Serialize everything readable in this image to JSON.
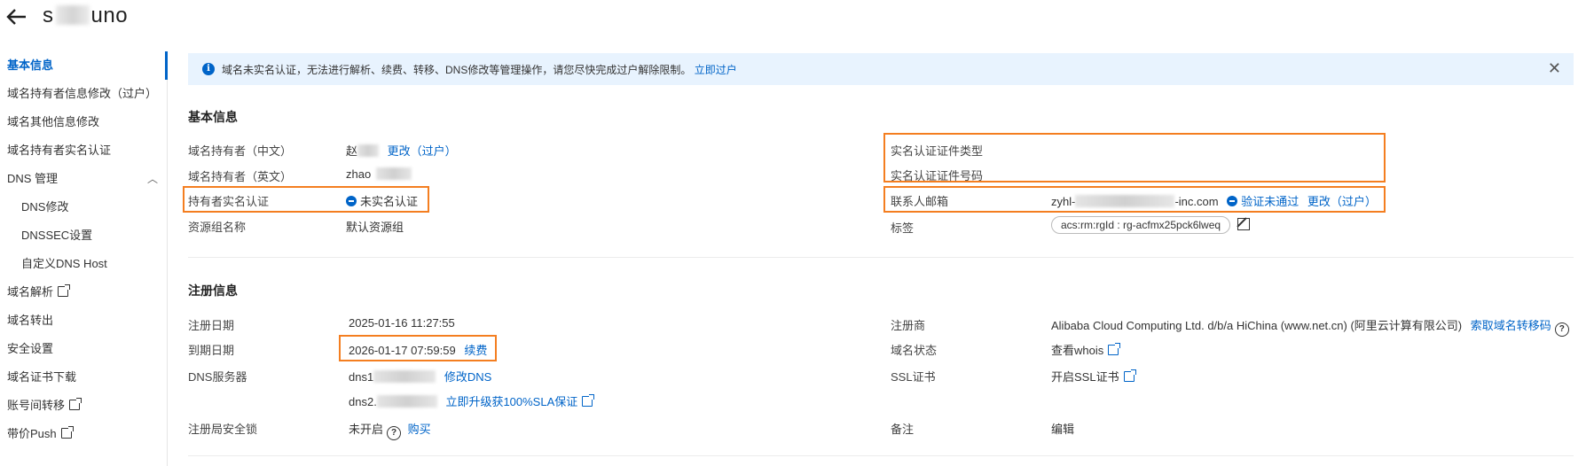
{
  "header": {
    "title_start": "s",
    "title_end": "uno"
  },
  "sidebar": {
    "items": [
      {
        "label": "基本信息"
      },
      {
        "label": "域名持有者信息修改（过户）"
      },
      {
        "label": "域名其他信息修改"
      },
      {
        "label": "域名持有者实名认证"
      },
      {
        "label": "DNS 管理"
      },
      {
        "label": "DNS修改"
      },
      {
        "label": "DNSSEC设置"
      },
      {
        "label": "自定义DNS Host"
      },
      {
        "label": "域名解析"
      },
      {
        "label": "域名转出"
      },
      {
        "label": "安全设置"
      },
      {
        "label": "域名证书下载"
      },
      {
        "label": "账号间转移"
      },
      {
        "label": "带价Push"
      }
    ]
  },
  "alert": {
    "text": "域名未实名认证，无法进行解析、续费、转移、DNS修改等管理操作，请您尽快完成过户解除限制。",
    "link": "立即过户",
    "close": "✕"
  },
  "basic": {
    "title": "基本信息",
    "owner_cn_label": "域名持有者（中文）",
    "owner_cn_value": "赵",
    "owner_cn_change": "更改（过户）",
    "owner_en_label": "域名持有者（英文）",
    "owner_en_value": "zhao",
    "verify_label": "持有者实名认证",
    "verify_status": "未实名认证",
    "group_label": "资源组名称",
    "group_value": "默认资源组",
    "cert_type_label": "实名认证证件类型",
    "cert_no_label": "实名认证证件号码",
    "email_label": "联系人邮箱",
    "email_start": "zyhl-",
    "email_end": "-inc.com",
    "email_status": "验证未通过",
    "email_change": "更改（过户）",
    "tag_label": "标签",
    "tag_value": "acs:rm:rgId : rg-acfmx25pck6lweq"
  },
  "register": {
    "title": "注册信息",
    "reg_date_label": "注册日期",
    "reg_date_value": "2025-01-16 11:27:55",
    "exp_date_label": "到期日期",
    "exp_date_value": "2026-01-17 07:59:59",
    "renew": "续费",
    "dns_label": "DNS服务器",
    "dns1": "dns1",
    "dns1_action": "修改DNS",
    "dns2": "dns2.",
    "dns2_action": "立即升级获100%SLA保证",
    "lock_label": "注册局安全锁",
    "lock_value": "未开启",
    "lock_action": "购买",
    "registrar_label": "注册商",
    "registrar_value": "Alibaba Cloud Computing Ltd. d/b/a HiChina (www.net.cn) (阿里云计算有限公司)",
    "registrar_action": "索取域名转移码",
    "status_label": "域名状态",
    "status_action": "查看whois",
    "ssl_label": "SSL证书",
    "ssl_action": "开启SSL证书",
    "remark_label": "备注",
    "remark_action": "编辑"
  },
  "colors": {
    "accent": "#0064c8",
    "highlight": "#f47e20",
    "alert_bg": "#e8f3fe"
  }
}
